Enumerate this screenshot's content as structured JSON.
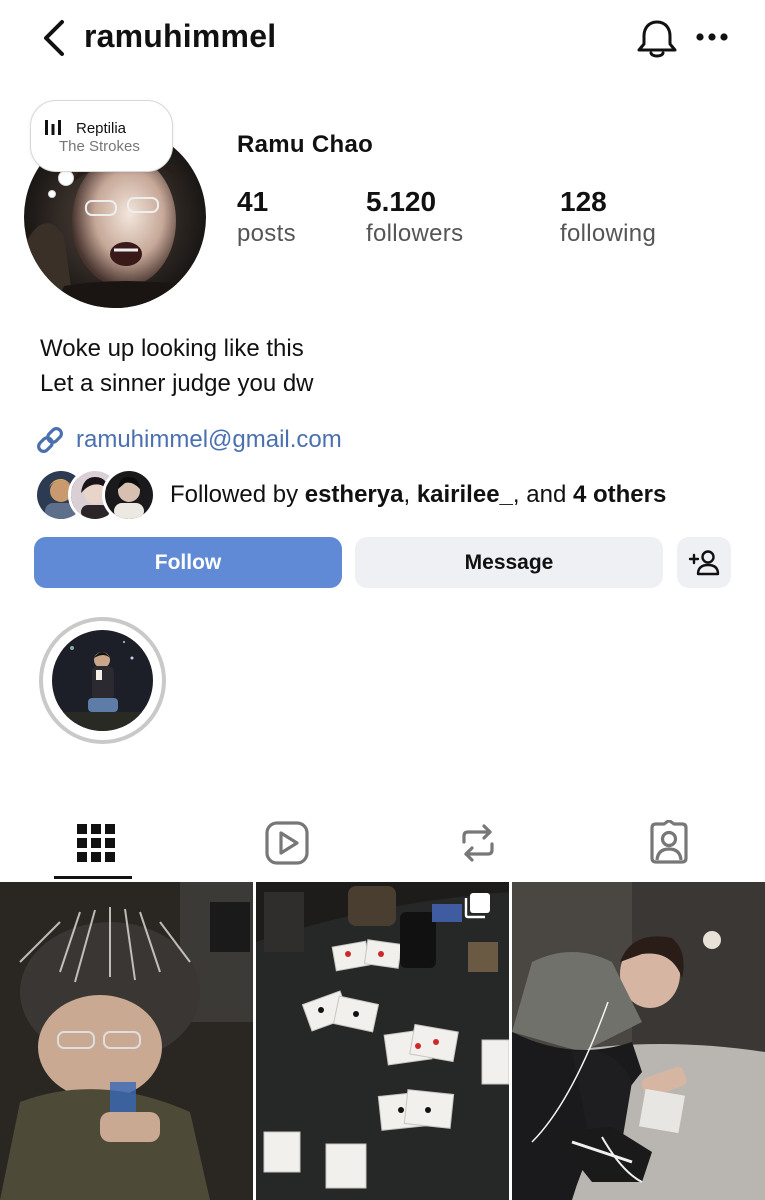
{
  "header": {
    "username": "ramuhimmel",
    "back_icon": "chevron-left-icon",
    "bell_icon": "bell-icon",
    "more_icon": "ellipsis-icon"
  },
  "note": {
    "icon": "audio-bars-icon",
    "song": "Reptilia",
    "artist": "The Strokes"
  },
  "profile": {
    "full_name": "Ramu Chao",
    "stats": {
      "posts": {
        "count": "41",
        "label": "posts"
      },
      "followers": {
        "count": "5.120",
        "label": "followers"
      },
      "following": {
        "count": "128",
        "label": "following"
      }
    },
    "bio": [
      "Woke up looking like this",
      "Let a sinner judge you dw"
    ],
    "link": {
      "icon": "link-icon",
      "text": "ramuhimmel@gmail.com"
    }
  },
  "followed_by": {
    "prefix": "Followed by ",
    "user1": "estherya",
    "sep": ", ",
    "user2": "kairilee_",
    "and": ", and ",
    "others": "4 others"
  },
  "actions": {
    "follow": "Follow",
    "message": "Message",
    "add_user_icon": "add-person-icon"
  },
  "tabs": [
    {
      "name": "posts-grid",
      "icon": "grid-icon",
      "active": true
    },
    {
      "name": "reels",
      "icon": "reels-play-icon",
      "active": false
    },
    {
      "name": "reposts",
      "icon": "repost-icon",
      "active": false
    },
    {
      "name": "tagged",
      "icon": "tagged-person-icon",
      "active": false
    }
  ],
  "colors": {
    "accent": "#6089d6",
    "link": "#4a70b0",
    "button_secondary": "#eff0f3"
  }
}
